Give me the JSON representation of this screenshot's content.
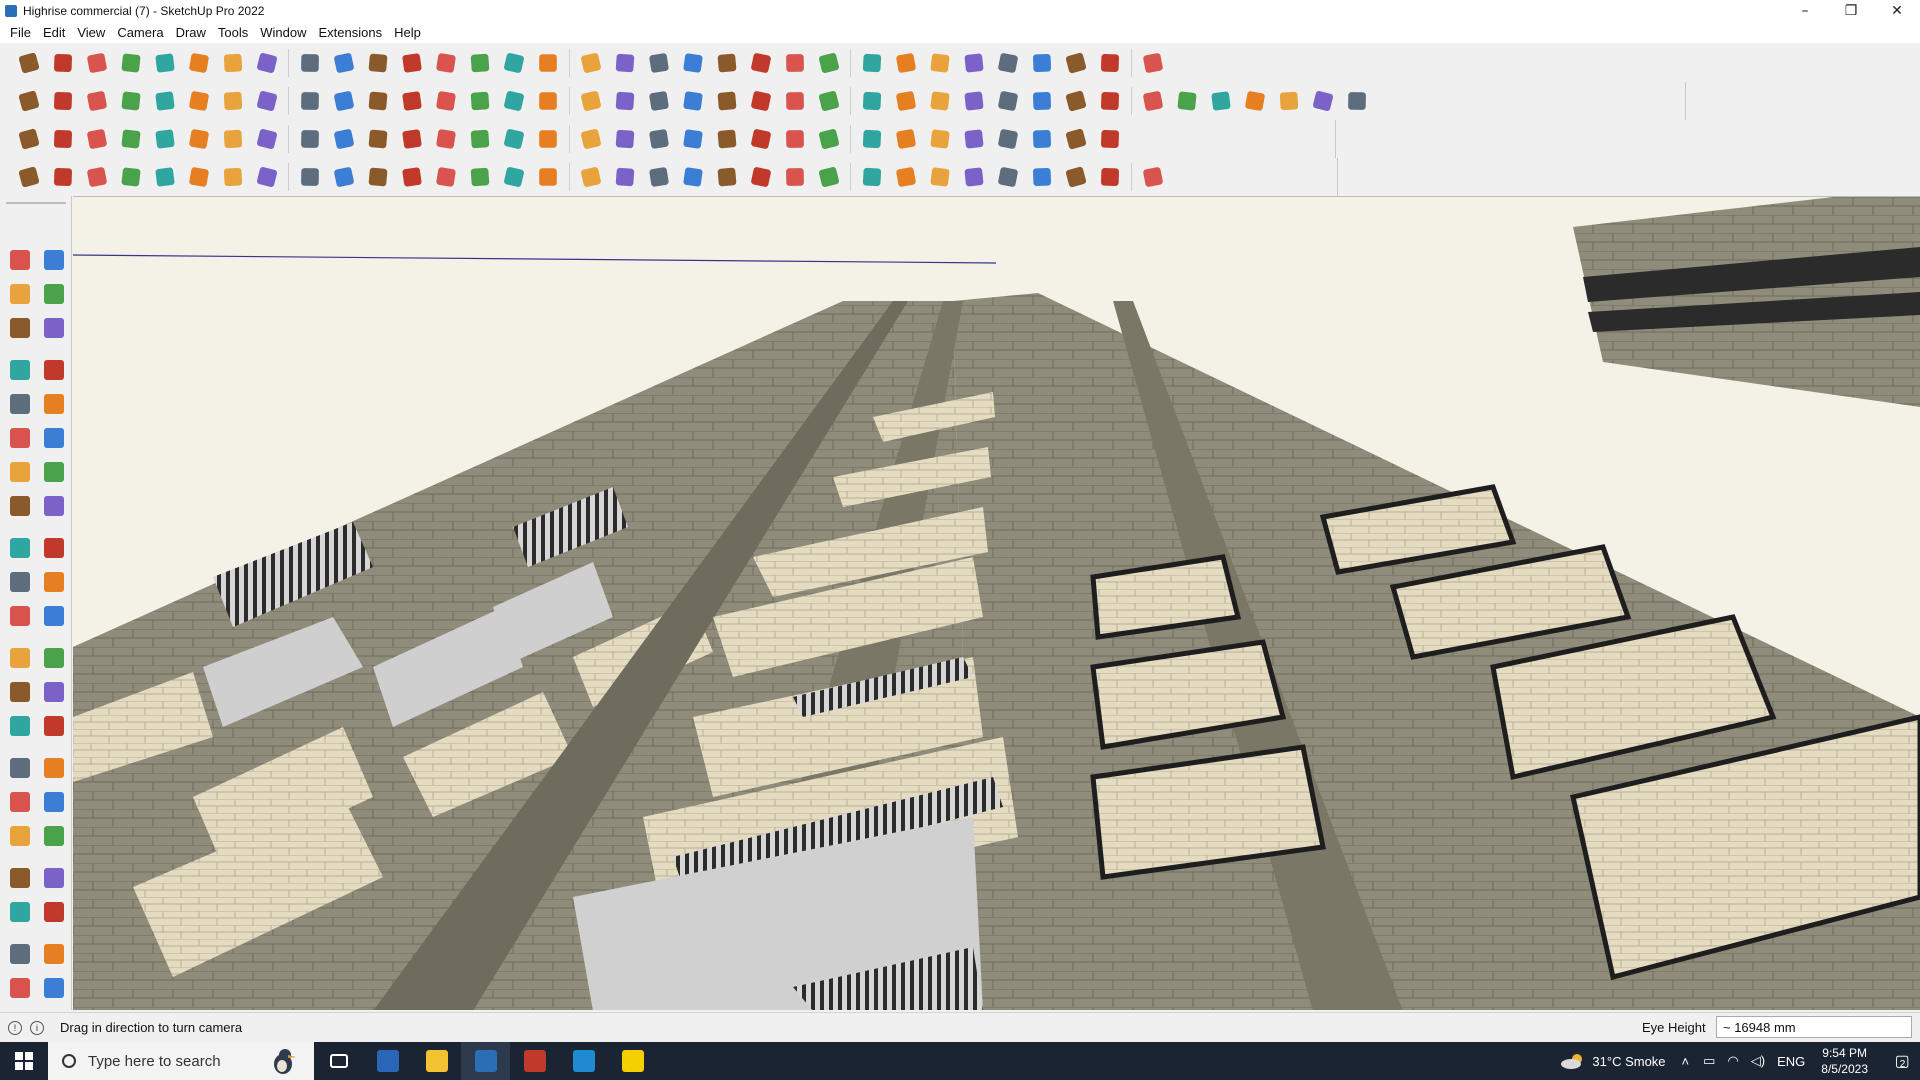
{
  "window": {
    "title": "Highrise commercial (7) - SketchUp Pro 2022",
    "minimize": "–",
    "restore": "❐",
    "close": "✕"
  },
  "menu": [
    "File",
    "Edit",
    "View",
    "Camera",
    "Draw",
    "Tools",
    "Window",
    "Extensions",
    "Help"
  ],
  "colors": {
    "accent": "#2a6fb5",
    "taskbar": "#1b2433",
    "viewport_sky": "#f4f1e6",
    "building_stone": "#8a8776",
    "building_light": "#e6dcc2",
    "glass": "#d2d2d2"
  },
  "toolbars": {
    "row1_icons": [
      "search-icon",
      "select-icon",
      "eraser-icon",
      "pencil-icon",
      "lasso-icon",
      "rectangle-icon",
      "pushpull-icon",
      "followme-icon",
      "move-icon",
      "rotate-icon",
      "scale-icon",
      "tapemeasure-icon",
      "text-icon",
      "paint-icon",
      "orbit-icon",
      "pan-icon",
      "zoom-icon",
      "zoomextents-icon",
      "section-icon",
      "xray-icon",
      "layers-icon",
      "styles-icon",
      "profile-icon",
      "warehouse-icon",
      "extension-icon",
      "sandbox-icon",
      "stack-icon",
      "flip-icon",
      "axis-icon",
      "view-icon",
      "undo-icon",
      "redo-icon",
      "tag-icon"
    ],
    "row2_icons": [
      "box-icon",
      "sphere-icon",
      "cylinder-icon",
      "solid-icon",
      "union-icon",
      "subtract-icon",
      "intersect-icon",
      "trim-icon",
      "split-icon",
      "outer-icon",
      "fillet-icon",
      "chamfer-icon",
      "offset-icon",
      "plane-icon",
      "house-icon",
      "roof-icon",
      "wall-icon",
      "door-icon",
      "window-icon",
      "stair-icon",
      "label-icon",
      "measure-icon",
      "curve-icon",
      "circle-icon",
      "polygon-icon",
      "ellipse-icon",
      "arc-icon",
      "spline-icon",
      "bezier-icon",
      "loft-icon",
      "sweep-icon",
      "shell-icon",
      "texture-icon",
      "cube-icon",
      "pyramid-icon",
      "prism-icon",
      "cone-icon",
      "torus-icon",
      "mesh-icon"
    ],
    "row3_icons": [
      "face-icon",
      "flatten-icon",
      "stack-icon",
      "extrude-icon",
      "tile-icon",
      "weld-icon",
      "join-icon",
      "explode-icon",
      "grid-icon",
      "panel-icon",
      "beam-icon",
      "column-icon",
      "slab-icon",
      "rail-icon",
      "fence-icon",
      "tree-icon",
      "light-icon",
      "camera-icon",
      "render-icon",
      "material-icon",
      "scene-icon",
      "animate-icon",
      "export-icon",
      "import-icon",
      "plugin-icon",
      "scatter-icon",
      "array-icon",
      "copy-icon",
      "mirror-icon",
      "align-icon",
      "snap-icon",
      "group-icon"
    ],
    "row4_icons": [
      "draw-icon",
      "polyline-icon",
      "freehand-icon",
      "divide-icon",
      "gear-icon",
      "cloud-icon",
      "pipe-icon",
      "sheet-icon",
      "vertex-icon",
      "soften-icon",
      "smooth-icon",
      "crease-icon",
      "slice-icon",
      "cut-icon",
      "knife-icon",
      "trim2-icon",
      "extend-icon",
      "fillet2-icon",
      "stairs2-icon",
      "railing-icon",
      "balustrade-icon",
      "grill-icon",
      "louver-icon",
      "truss-icon",
      "frame-icon",
      "ladder-icon",
      "shade-icon",
      "canopy-icon",
      "parapet-icon",
      "cornice-icon",
      "molding-icon",
      "corbel-icon",
      "bracket-icon"
    ]
  },
  "left_tools": [
    [
      "select-tool-icon",
      "orbit-tool-icon"
    ],
    [
      "paint-tool-icon",
      "eraser-tool-icon"
    ],
    [
      "component-tool-icon",
      "tag-tool-icon"
    ],
    [
      "line-tool-icon",
      "freehand-tool-icon"
    ],
    [
      "rectangle-tool-icon",
      "rotated-rect-tool-icon"
    ],
    [
      "circle-tool-icon",
      "polygon-tool-icon"
    ],
    [
      "arc-tool-icon",
      "pie-tool-icon"
    ],
    [
      "arc2-tool-icon",
      "arc3-tool-icon"
    ],
    [
      "move-tool-icon",
      "pushpull-tool-icon"
    ],
    [
      "rotate-tool-icon",
      "followme-tool-icon"
    ],
    [
      "scale-tool-icon",
      "offset-tool-icon"
    ],
    [
      "tape-tool-icon",
      "dimension-tool-icon"
    ],
    [
      "protractor-tool-icon",
      "text-tool-icon"
    ],
    [
      "axes-tool-icon",
      "3dtext-tool-icon"
    ],
    [
      "orbit2-tool-icon",
      "pan-tool-icon"
    ],
    [
      "zoom-tool-icon",
      "zoomwindow-tool-icon"
    ],
    [
      "zoomextents-tool-icon",
      "previous-tool-icon"
    ],
    [
      "position-camera-icon",
      "look-around-icon"
    ],
    [
      "walk-tool-icon",
      "section-plane-icon"
    ],
    [
      "section-display-icon",
      "section-cut-icon"
    ],
    [
      "section-fill-icon",
      "section-toggle-icon"
    ]
  ],
  "status": {
    "hint": "Drag in direction to turn camera",
    "measure_label": "Eye Height",
    "measure_value": "~ 16948 mm"
  },
  "taskbar": {
    "search_placeholder": "Type here to search",
    "weather": "31°C  Smoke",
    "lang": "ENG",
    "time": "9:54 PM",
    "date": "8/5/2023",
    "notif_count": "2",
    "apps": [
      "task-view-icon",
      "calculator-icon",
      "file-explorer-icon",
      "sketchup-icon",
      "acrobat-icon",
      "edge-icon",
      "sticky-notes-icon"
    ]
  }
}
